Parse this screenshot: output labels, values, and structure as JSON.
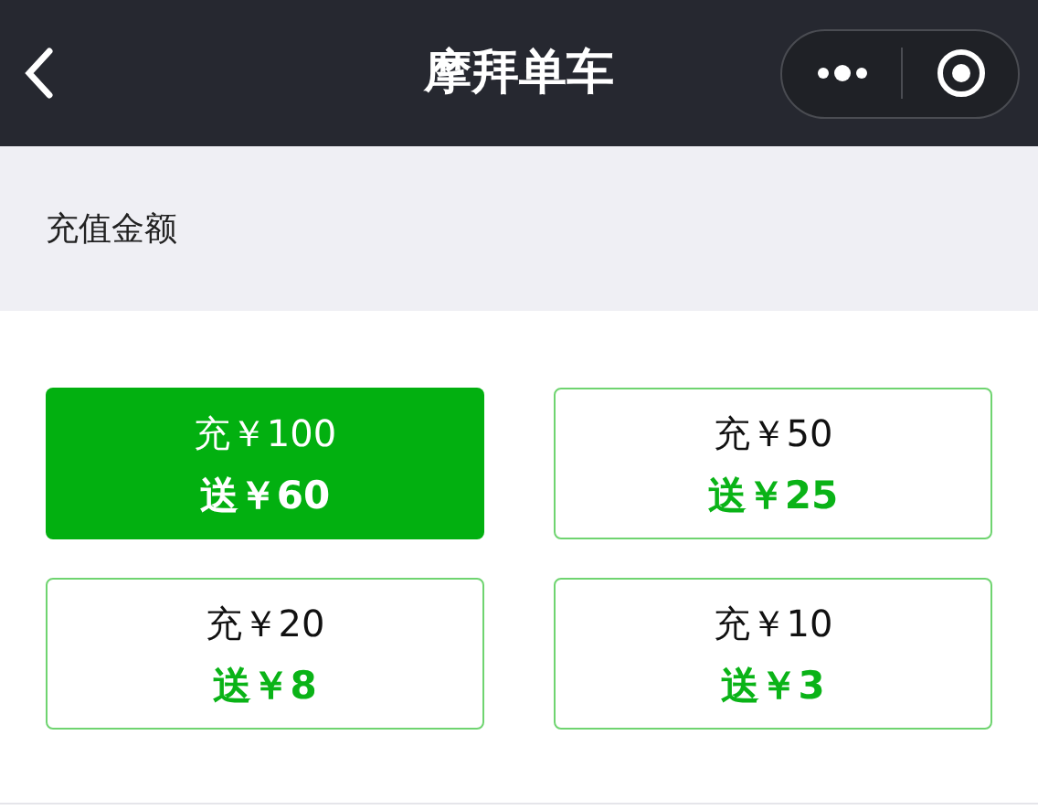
{
  "nav_bar": {
    "title": "摩拜单车"
  },
  "section": {
    "label": "充值金额"
  },
  "options": [
    {
      "charge": "充￥100",
      "bonus": "送￥60",
      "selected": true
    },
    {
      "charge": "充￥50",
      "bonus": "送￥25",
      "selected": false
    },
    {
      "charge": "充￥20",
      "bonus": "送￥8",
      "selected": false
    },
    {
      "charge": "充￥10",
      "bonus": "送￥3",
      "selected": false
    }
  ]
}
